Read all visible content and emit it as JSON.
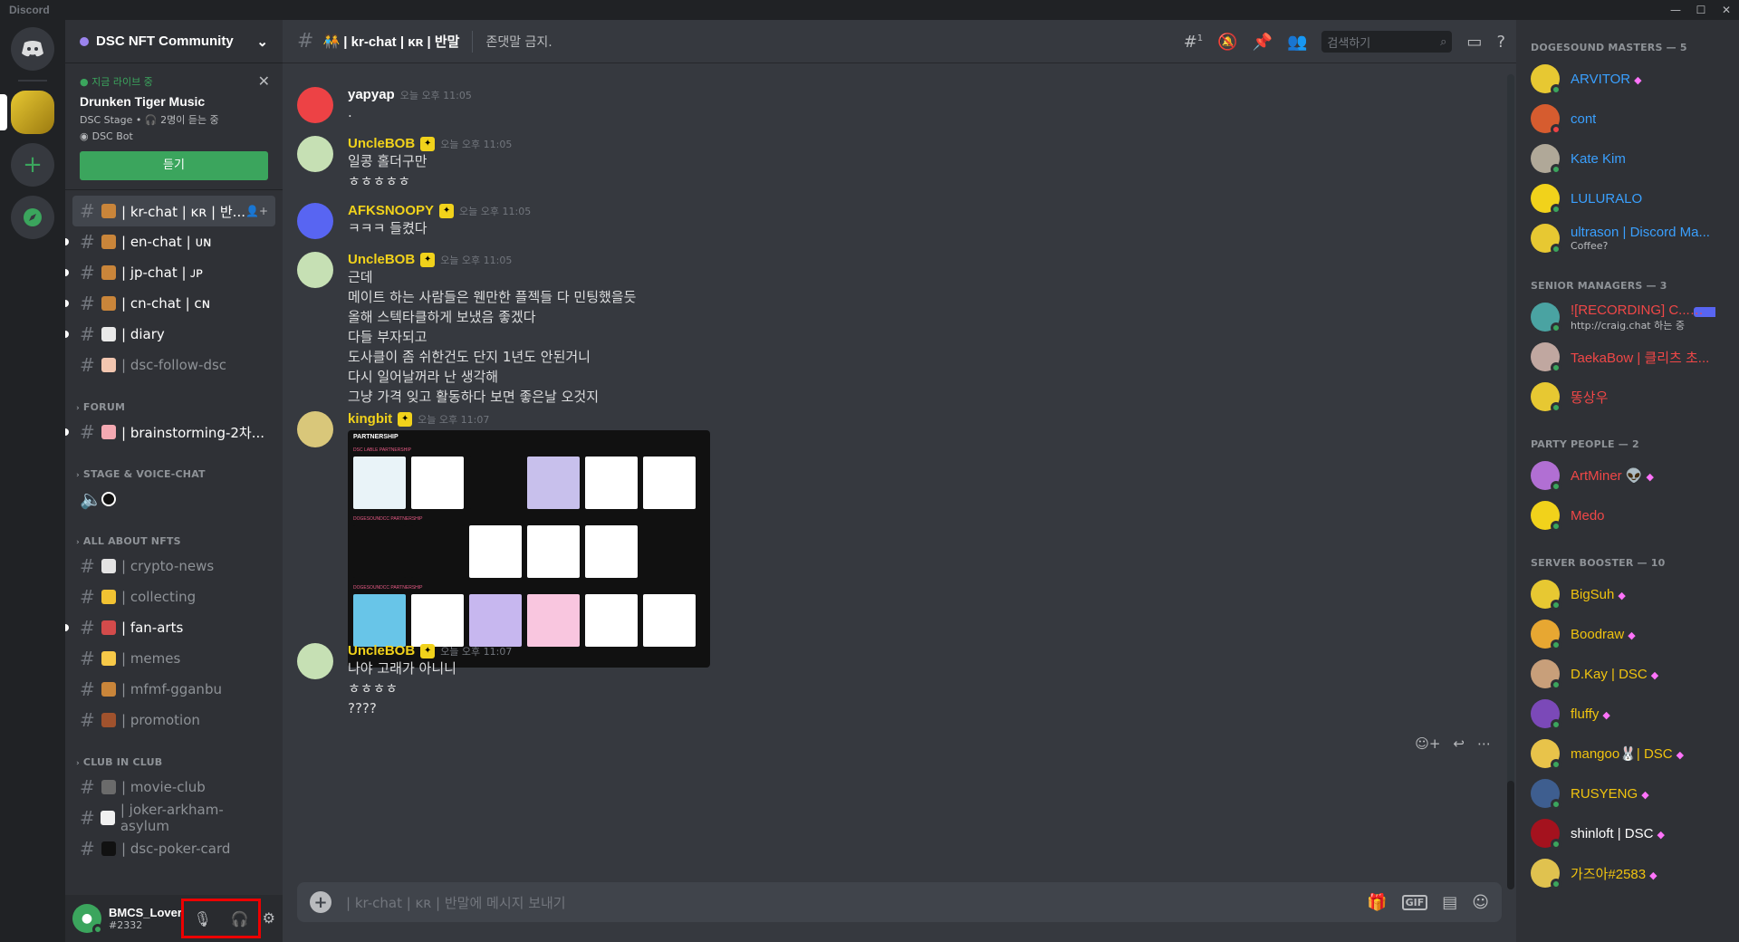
{
  "app": {
    "title": "Discord"
  },
  "server": {
    "name": "DSC NFT Community"
  },
  "live": {
    "label": "● 지금 라이브 중",
    "title": "Drunken Tiger Music",
    "meta": "DSC Stage • 🎧 2명이 듣는 중",
    "bot": "DSC Bot",
    "button": "듣기"
  },
  "channels": [
    {
      "name": "| kr-chat | ᴋʀ | 반...",
      "active": true,
      "emo": "#c9853a"
    },
    {
      "name": "| en-chat | ᴜɴ",
      "unread": true,
      "emo": "#c9853a"
    },
    {
      "name": "| jp-chat | ᴊᴘ",
      "unread": true,
      "emo": "#c9853a"
    },
    {
      "name": "| cn-chat | ᴄɴ",
      "unread": true,
      "emo": "#c9853a"
    },
    {
      "name": "| diary",
      "unread": true,
      "emo": "#e9e9e9"
    },
    {
      "name": "| dsc-follow-dsc",
      "emo": "#f2c6b0"
    }
  ],
  "categories": {
    "forum": "FORUM",
    "stage": "STAGE & VOICE-CHAT",
    "nfts": "ALL ABOUT NFTS",
    "club": "CLUB IN CLUB"
  },
  "forum_channels": [
    {
      "name": "| brainstorming-2차...",
      "unread": true,
      "emo": "#f4a9b2"
    }
  ],
  "nft_channels": [
    {
      "name": "| crypto-news",
      "emo": "#e3e3e3"
    },
    {
      "name": "| collecting",
      "emo": "#f1c232"
    },
    {
      "name": "| fan-arts",
      "unread": true,
      "emo": "#d34b4b"
    },
    {
      "name": "| memes",
      "emo": "#f7c948"
    },
    {
      "name": "| mfmf-gganbu",
      "emo": "#c9853a"
    },
    {
      "name": "| promotion",
      "emo": "#a0522d"
    }
  ],
  "club_channels": [
    {
      "name": "| movie-club",
      "emo": "#6b6b6b"
    },
    {
      "name": "| joker-arkham-asylum",
      "emo": "#f0f0f0"
    },
    {
      "name": "| dsc-poker-card",
      "emo": "#111111"
    }
  ],
  "user": {
    "name": "BMCS_Lover",
    "discriminator": "#2332"
  },
  "chat": {
    "channel": "🧑‍🤝‍🧑 | kr-chat | ᴋʀ | 반말",
    "topic": "존댓말 금지.",
    "threads_count": "1",
    "search_placeholder": "검색하기",
    "composer_placeholder": "| kr-chat | ᴋʀ | 반말에 메시지 보내기"
  },
  "messages": [
    {
      "author": "yapyap",
      "color": "#ffffff",
      "avatar": "#ed4245",
      "time": "오늘 오후 11:05",
      "lines": [
        "."
      ],
      "badge": false
    },
    {
      "author": "UncleBOB",
      "color": "#f1d21b",
      "avatar": "#c6e0b4",
      "time": "오늘 오후 11:05",
      "lines": [
        "일콩 홀더구만",
        "ㅎㅎㅎㅎㅎ"
      ],
      "badge": true
    },
    {
      "author": "AFKSNOOPY",
      "color": "#f1d21b",
      "avatar": "#5865f2",
      "time": "오늘 오후 11:05",
      "lines": [
        "ㅋㅋㅋ 들켰다"
      ],
      "badge": true
    },
    {
      "author": "UncleBOB",
      "color": "#f1d21b",
      "avatar": "#c6e0b4",
      "time": "오늘 오후 11:05",
      "lines": [
        "근데",
        "메이트 하는 사람들은 웬만한 플젝들 다 민팅했을듯",
        "올해 스텍타클하게 보냈음 좋겠다",
        "다들 부자되고",
        "도사클이 좀 쉬한건도 단지 1년도 안된거니",
        "다시 일어날꺼라 난 생각해",
        "그냥 가격 잊고 활동하다 보면 좋은날 오것지"
      ],
      "badge": true
    },
    {
      "author": "kingbit",
      "color": "#f1d21b",
      "avatar": "#d9c77a",
      "time": "오늘 오후 11:07",
      "lines": [],
      "badge": true,
      "embed": {
        "title": "PARTNERSHIP",
        "s1": "DSC LABLE PARTNERSHIP",
        "s2": "DOGESOUNDCC PARTNERSHIP",
        "s3": "DOGESOUNDCC PARTNERSHIP"
      }
    },
    {
      "author": "UncleBOB",
      "color": "#f1d21b",
      "avatar": "#c6e0b4",
      "time": "오늘 오후 11:07",
      "lines": [
        "나야 고래가 아니니",
        "ㅎㅎㅎㅎ",
        "????"
      ],
      "badge": true
    }
  ],
  "member_sections": [
    {
      "title": "DOGESOUND MASTERS — 5",
      "members": [
        {
          "name": "ARVITOR",
          "color": "#3aa0ff",
          "av": "#e7c832",
          "status": "#3ba55d",
          "boost": true
        },
        {
          "name": "cont",
          "color": "#3aa0ff",
          "av": "#d65c2f",
          "status": "#ed4245"
        },
        {
          "name": "Kate Kim",
          "color": "#3aa0ff",
          "av": "#b0a898",
          "status": "#3ba55d"
        },
        {
          "name": "LULURALO",
          "color": "#3aa0ff",
          "av": "#f1d21b",
          "status": "#3ba55d"
        },
        {
          "name": "ultrason | Discord Ma...",
          "color": "#3aa0ff",
          "av": "#e7c832",
          "status": "#3ba55d",
          "sub": "Coffee?"
        }
      ]
    },
    {
      "title": "SENIOR MANAGERS — 3",
      "members": [
        {
          "name": "![RECORDING] C...",
          "color": "#f04747",
          "av": "#4aa3a2",
          "status": "#3ba55d",
          "sub": "http://craig.chat 하는 중",
          "tag": "✓ 봇"
        },
        {
          "name": "TaekaBow | 클리츠 초...",
          "color": "#f04747",
          "av": "#c0a7a0",
          "status": "#3ba55d"
        },
        {
          "name": "똥상우",
          "color": "#f04747",
          "av": "#e7c832",
          "status": "#3ba55d"
        }
      ]
    },
    {
      "title": "PARTY PEOPLE — 2",
      "members": [
        {
          "name": "ArtMiner 👽",
          "color": "#f04747",
          "av": "#b16fd3",
          "status": "#3ba55d",
          "boost": true
        },
        {
          "name": "Medo",
          "color": "#f04747",
          "av": "#f1d21b",
          "status": "#3ba55d"
        }
      ]
    },
    {
      "title": "SERVER BOOSTER — 10",
      "members": [
        {
          "name": "BigSuh",
          "color": "#f1c40f",
          "av": "#e7c832",
          "status": "#3ba55d",
          "boost": true
        },
        {
          "name": "Boodraw",
          "color": "#f1c40f",
          "av": "#e7a732",
          "status": "#3ba55d",
          "boost": true
        },
        {
          "name": "D.Kay | DSC",
          "color": "#f1c40f",
          "av": "#c89f7a",
          "status": "#3ba55d",
          "boost": true
        },
        {
          "name": "fluffy",
          "color": "#f1c40f",
          "av": "#7b49b8",
          "status": "#3ba55d",
          "boost": true
        },
        {
          "name": "mangoo🐰| DSC",
          "color": "#f1c40f",
          "av": "#e8c34a",
          "status": "#3ba55d",
          "boost": true
        },
        {
          "name": "RUSYENG",
          "color": "#f1c40f",
          "av": "#3e5e8f",
          "status": "#3ba55d",
          "boost": true
        },
        {
          "name": "shinloft | DSC",
          "color": "#ffffff",
          "av": "#a4121e",
          "status": "#3ba55d",
          "boost": true
        },
        {
          "name": "가즈아#2583",
          "color": "#f1c40f",
          "av": "#e0c24f",
          "status": "#3ba55d",
          "boost": true
        }
      ]
    }
  ]
}
